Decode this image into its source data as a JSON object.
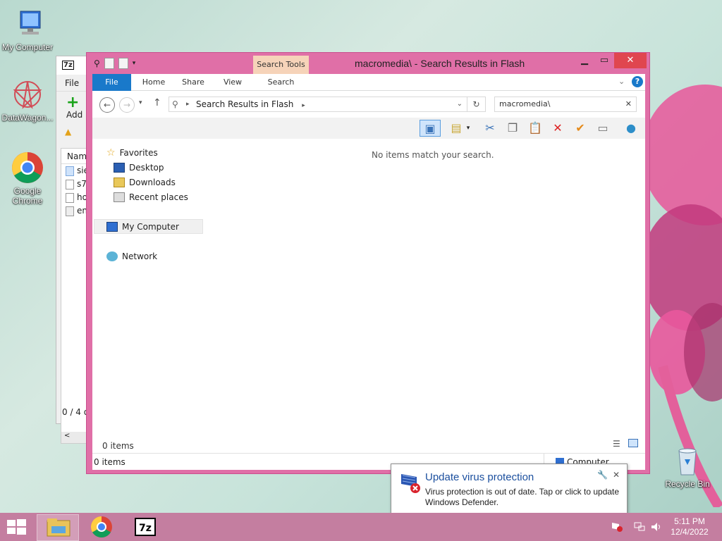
{
  "desktop": {
    "icons": [
      {
        "label": "My Computer"
      },
      {
        "label": "DataWagon..."
      },
      {
        "label": "Google Chrome"
      },
      {
        "label": "Recycle Bin"
      }
    ]
  },
  "bg_window": {
    "icon_text": "7z",
    "menu_file": "File",
    "add_label": "Add",
    "list_header": "Name",
    "rows": [
      "sie",
      "s7",
      "ho",
      "en"
    ],
    "status": "0 / 4 o"
  },
  "explorer": {
    "title": "macromedia\\ - Search Results in Flash",
    "contextual_tab": "Search Tools",
    "ribbon_tabs": [
      "File",
      "Home",
      "Share",
      "View",
      "Search"
    ],
    "breadcrumb": "Search Results in Flash",
    "search_value": "macromedia\\",
    "nav": {
      "favorites": "Favorites",
      "desktop": "Desktop",
      "downloads": "Downloads",
      "recent": "Recent places",
      "computer": "My Computer",
      "network": "Network"
    },
    "empty_message": "No items match your search.",
    "inner_count": "0 items",
    "status_count": "0 items",
    "status_location": "Computer",
    "accent_color": "#e06fa7"
  },
  "toast": {
    "title": "Update virus protection",
    "body": "Virus protection is out of date. Tap or click to update Windows Defender."
  },
  "taskbar": {
    "apps": [
      "file-explorer",
      "google-chrome",
      "7-zip"
    ],
    "clock_time": "5:11 PM",
    "clock_date": "12/4/2022"
  }
}
